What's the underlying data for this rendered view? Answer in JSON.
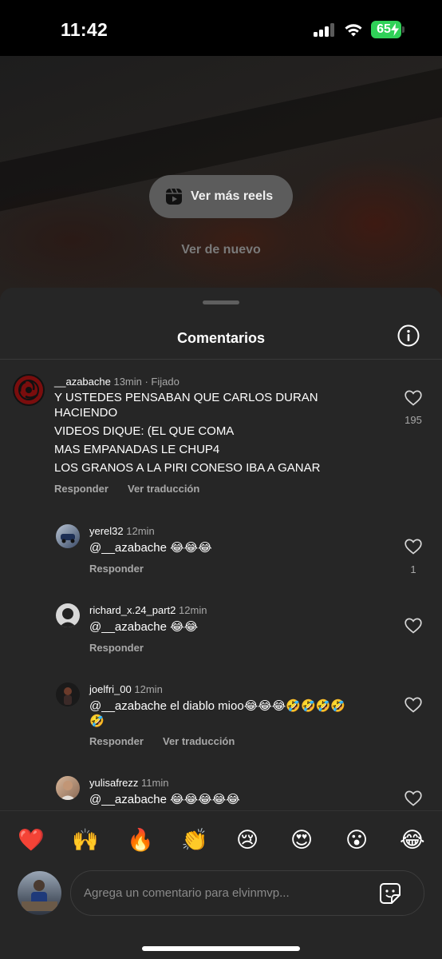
{
  "status_bar": {
    "time": "11:42",
    "battery": "65"
  },
  "video": {
    "more_reels_label": "Ver más reels",
    "watch_again_label": "Ver de nuevo"
  },
  "sheet": {
    "title": "Comentarios"
  },
  "comments": [
    {
      "username": "__azabache",
      "time": "13min · Fijado",
      "lines": [
        "Y USTEDES PENSABAN QUE CARLOS DURAN",
        "HACIENDO",
        "VIDEOS DIQUE: (EL QUE COMA",
        "MAS EMPANADAS LE CHUP4",
        "LOS GRANOS A LA PIRI CONESO IBA A GANAR"
      ],
      "reply_label": "Responder",
      "translate_label": "Ver traducción",
      "likes": "195"
    },
    {
      "username": "yerel32",
      "time": "12min",
      "lines": [
        "@__azabache 😂😂😂"
      ],
      "reply_label": "Responder",
      "likes": "1"
    },
    {
      "username": "richard_x.24_part2",
      "time": "12min",
      "lines": [
        "@__azabache 😂😂"
      ],
      "reply_label": "Responder"
    },
    {
      "username": "joelfri_00",
      "time": "12min",
      "lines": [
        "@__azabache el diablo mioo😂😂😂🤣🤣🤣🤣",
        "🤣"
      ],
      "reply_label": "Responder",
      "translate_label": "Ver traducción"
    },
    {
      "username": "yulisafrezz",
      "time": "11min",
      "lines": [
        "@__azabache 😂😂😂😂😂"
      ]
    }
  ],
  "emoji_bar": [
    "❤️",
    "🙌",
    "🔥",
    "👏",
    "😢",
    "😍",
    "😮",
    "😂"
  ],
  "input": {
    "placeholder": "Agrega un comentario para elvinmvp..."
  },
  "colors": {
    "sheet_bg": "#262626",
    "secondary_text": "#a8a8a8",
    "battery_green": "#30d158"
  }
}
